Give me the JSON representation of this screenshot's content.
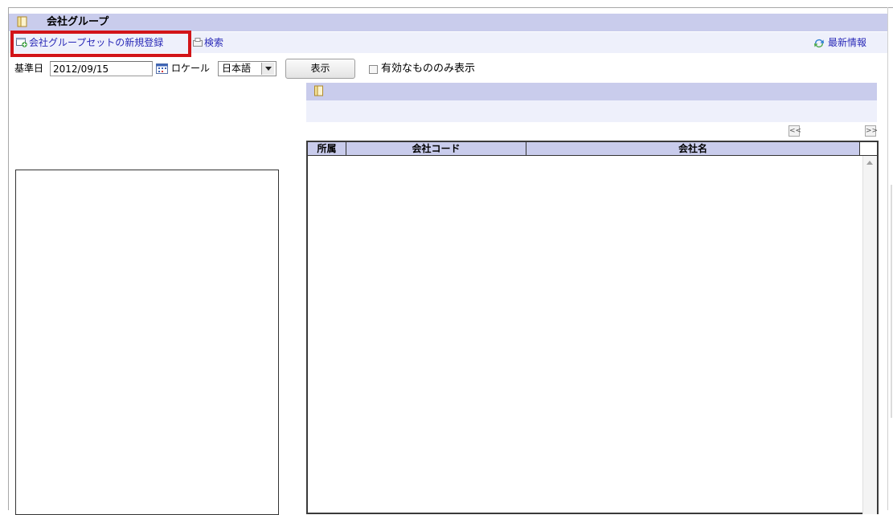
{
  "header": {
    "title": "会社グループ"
  },
  "toolbar": {
    "new_registration": "会社グループセットの新規登録",
    "search": "検索",
    "refresh": "最新情報"
  },
  "filters": {
    "date_label": "基準日",
    "date_value": "2012/09/15",
    "locale_label": "ロケール",
    "locale_value": "日本語",
    "show_button": "表示",
    "valid_only_label": "有効なもののみ表示"
  },
  "pager": {
    "prev": "<<",
    "next": ">>"
  },
  "table": {
    "columns": [
      "所属",
      "会社コード",
      "会社名"
    ]
  },
  "colors": {
    "header_bg": "#c9ccec",
    "toolbar_bg": "#eef0fb",
    "link": "#2a2ab8",
    "highlight": "#d21418"
  }
}
